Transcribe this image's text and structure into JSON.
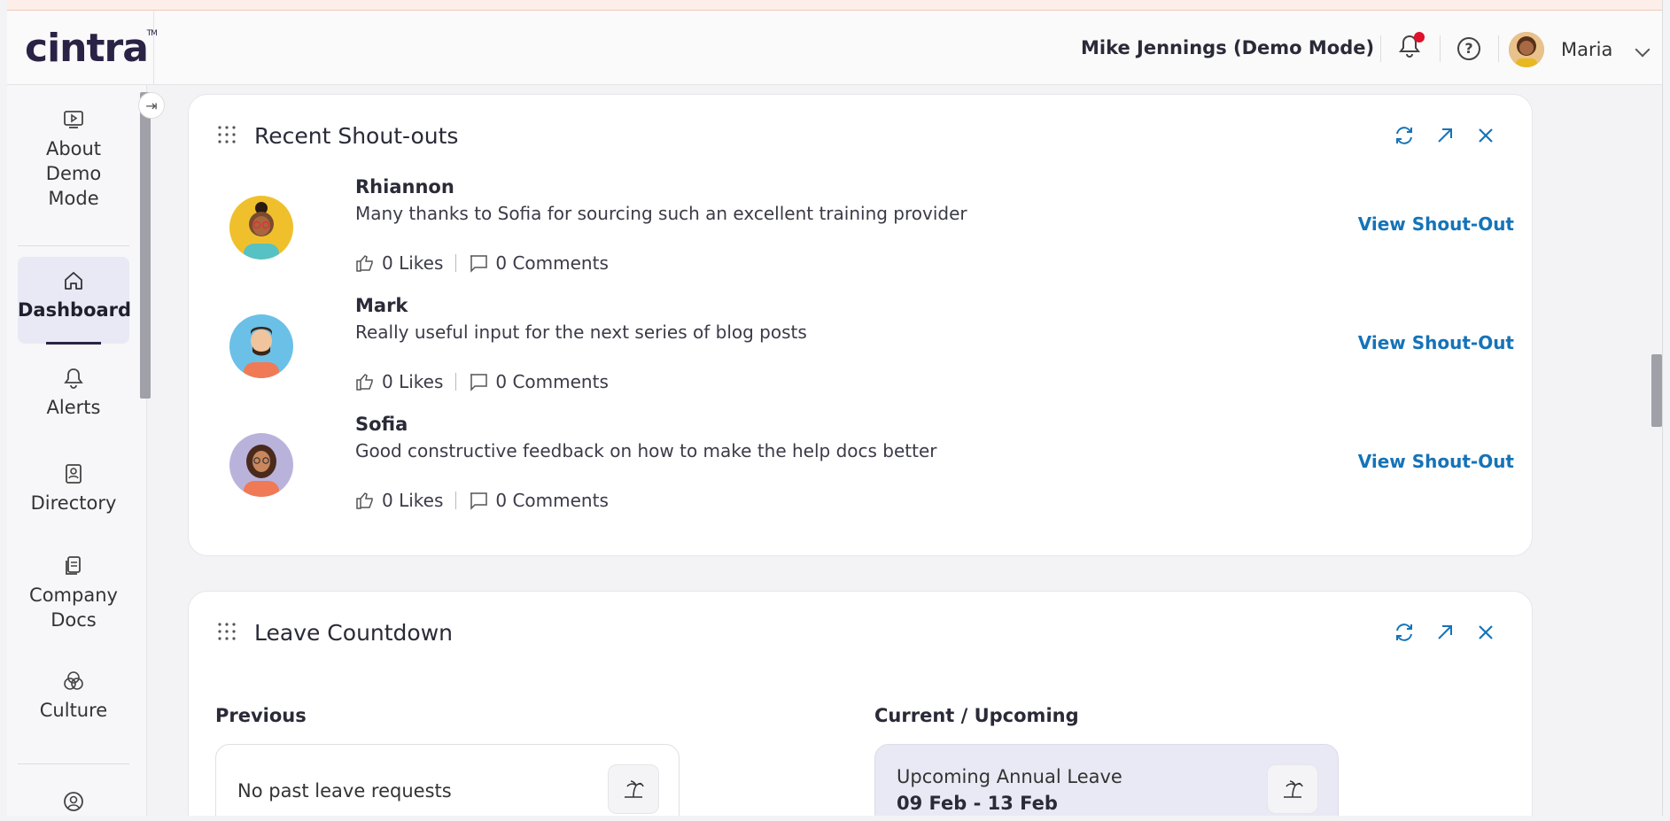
{
  "header": {
    "logo_text": "cintra",
    "logo_tm": "TM",
    "user_display": "Mike Jennings (Demo Mode)",
    "profile_name": "Maria",
    "notification_dot_color": "#e0112b",
    "help_glyph": "?"
  },
  "sidebar": {
    "collapse_glyph": "⇥",
    "items": [
      {
        "label": "About Demo Mode",
        "icon": "play-screen-icon"
      },
      {
        "label": "Dashboard",
        "icon": "home-icon",
        "active": true
      },
      {
        "label": "Alerts",
        "icon": "bell-icon"
      },
      {
        "label": "Directory",
        "icon": "contact-book-icon"
      },
      {
        "label": "Company Docs",
        "icon": "documents-icon"
      },
      {
        "label": "Culture",
        "icon": "venn-icon"
      }
    ]
  },
  "shoutouts": {
    "title": "Recent Shout-outs",
    "items": [
      {
        "name": "Rhiannon",
        "message": "Many thanks to Sofia for sourcing such an excellent training provider",
        "likes": "0 Likes",
        "comments": "0 Comments",
        "action": "View Shout-Out"
      },
      {
        "name": "Mark",
        "message": "Really useful input for the next series of blog posts",
        "likes": "0 Likes",
        "comments": "0 Comments",
        "action": "View Shout-Out"
      },
      {
        "name": "Sofia",
        "message": "Good constructive feedback on how to make the help docs better",
        "likes": "0 Likes",
        "comments": "0 Comments",
        "action": "View Shout-Out"
      }
    ]
  },
  "leave": {
    "title": "Leave Countdown",
    "previous_heading": "Previous",
    "previous_text": "No past leave requests",
    "current_heading": "Current / Upcoming",
    "upcoming_title": "Upcoming Annual Leave",
    "upcoming_dates": "09 Feb - 13 Feb"
  },
  "colors": {
    "accent_blue": "#1573b8",
    "brand_navy": "#2b2346",
    "active_nav_bg": "#e8e9f4"
  }
}
